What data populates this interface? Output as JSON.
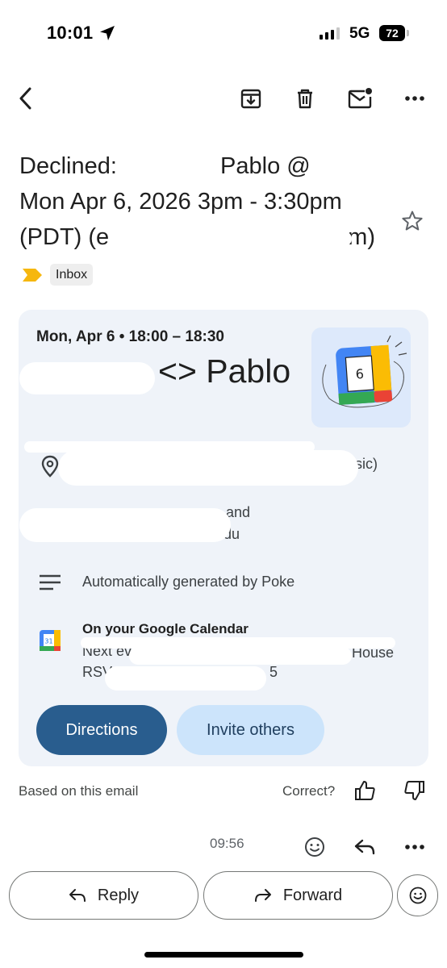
{
  "status_bar": {
    "time": "10:01",
    "network": "5G",
    "battery": "72"
  },
  "toolbar": {
    "back_icon": "back-arrow-icon",
    "archive_icon": "archive-icon",
    "delete_icon": "trash-icon",
    "mark_unread_icon": "mail-unread-icon",
    "more_icon": "more-horizontal-icon"
  },
  "email": {
    "subject_line1": "Declined: ",
    "subject_line1_tail": " Pablo @",
    "subject_line2": "Mon Apr 6, 2026 3pm - 3:30pm",
    "subject_line3_start": "(PDT) (e",
    "subject_line3_end": "m)",
    "label": "Inbox",
    "starred": false
  },
  "event_card": {
    "date_time": "Mon, Apr 6 • 18:00 – 18:30",
    "title": "<> Pablo",
    "calendar_day": "6",
    "location_tail": "sic)",
    "guests_line1": "and",
    "guests_line2": ".edu",
    "description": "Automatically generated by Poke",
    "calendar_heading": "On your Google Calendar",
    "calendar_icon_day": "31",
    "next_event_prefix": "Next event",
    "next_event_tail": "House",
    "rsvp_prefix": "RSV",
    "rsvp_tail": "5",
    "directions_label": "Directions",
    "invite_label": "Invite others"
  },
  "feedback": {
    "based_on": "Based on this email",
    "correct": "Correct?"
  },
  "next_message": {
    "time": "09:56"
  },
  "bottom_actions": {
    "reply_label": "Reply",
    "forward_label": "Forward"
  },
  "colors": {
    "card_bg": "#eff3f9",
    "primary_button": "#295d8e",
    "secondary_button": "#cce4fb",
    "label_marker": "#f6b70f"
  }
}
